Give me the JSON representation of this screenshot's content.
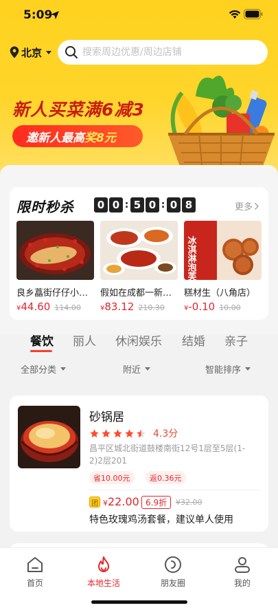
{
  "status_bar": {
    "time": "5:09"
  },
  "location": {
    "city": "北京"
  },
  "search": {
    "placeholder": "搜索周边优惠/周边店铺"
  },
  "banner": {
    "title": "新人买菜满6减3",
    "subtitle_prefix": "邀新人最高",
    "subtitle_highlight": "奖8元"
  },
  "flash_sale": {
    "title": "限时秒杀",
    "countdown": [
      "0",
      "0",
      "5",
      "0",
      "0",
      "8"
    ],
    "more": "更多",
    "currency": "¥",
    "deals": [
      {
        "name": "良乡藠街仔仔小…",
        "price": "44.60",
        "original": "114.00"
      },
      {
        "name": "假如在成都一新…",
        "price": "83.12",
        "original": "210.30"
      },
      {
        "name": "糕材生（八角店）",
        "price": "-0.10",
        "original": "10.00"
      }
    ],
    "deal3_image_text": "冰淇淋泡芙"
  },
  "category_tabs": [
    "餐饮",
    "丽人",
    "休闲娱乐",
    "结婚",
    "亲子"
  ],
  "filters": [
    "全部分类",
    "附近",
    "智能排序"
  ],
  "shop": {
    "name": "砂锅居",
    "rating": 4.3,
    "rating_text": "4.3分",
    "address": "昌平区城北街道鼓楼南街12号1层至5层(1-2)2层201",
    "tags": [
      "省10.00元",
      "返0.36元"
    ],
    "group_badge": "团",
    "group_price": "22.00",
    "discount": "6.9折",
    "group_original": "¥32.00",
    "group_desc": "特色玫瑰鸡汤套餐，建议单人使用"
  },
  "tabbar": [
    {
      "label": "首页",
      "icon": "home-icon"
    },
    {
      "label": "本地生活",
      "icon": "flame-icon"
    },
    {
      "label": "朋友圈",
      "icon": "friends-circle-icon"
    },
    {
      "label": "我的",
      "icon": "profile-icon"
    }
  ],
  "colors": {
    "brand_yellow": "#ffd21f",
    "accent_red": "#e3262b"
  }
}
